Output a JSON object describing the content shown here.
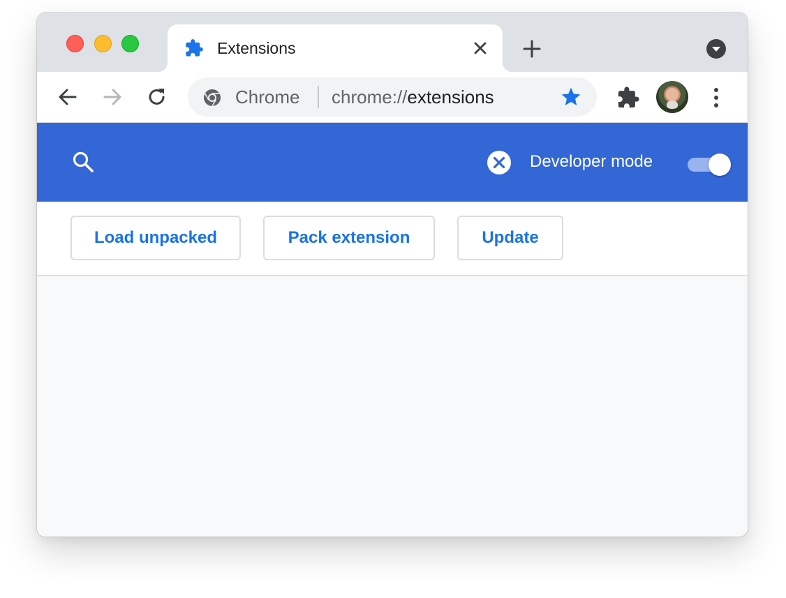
{
  "window": {
    "traffic_lights": [
      "close",
      "minimize",
      "zoom"
    ]
  },
  "tab": {
    "title": "Extensions",
    "icon": "puzzle-icon",
    "close_icon": "close-icon"
  },
  "toolbar": {
    "back_icon": "back-arrow-icon",
    "forward_icon": "forward-arrow-icon",
    "reload_icon": "reload-icon",
    "omnibox": {
      "site_label": "Chrome",
      "url_scheme": "chrome://",
      "url_path": "extensions",
      "bookmarked": true
    },
    "extensions_icon": "puzzle-icon",
    "menu_icon": "vertical-dots-icon"
  },
  "header": {
    "search_icon": "search-icon",
    "clear_icon": "clear-circle-icon",
    "developer_mode_label": "Developer mode",
    "developer_mode_enabled": true
  },
  "dev_buttons": {
    "load_unpacked": "Load unpacked",
    "pack_extension": "Pack extension",
    "update": "Update"
  },
  "colors": {
    "accent": "#1a73e8",
    "header_bg": "#3367d6",
    "tabstrip_bg": "#dee1e6"
  }
}
